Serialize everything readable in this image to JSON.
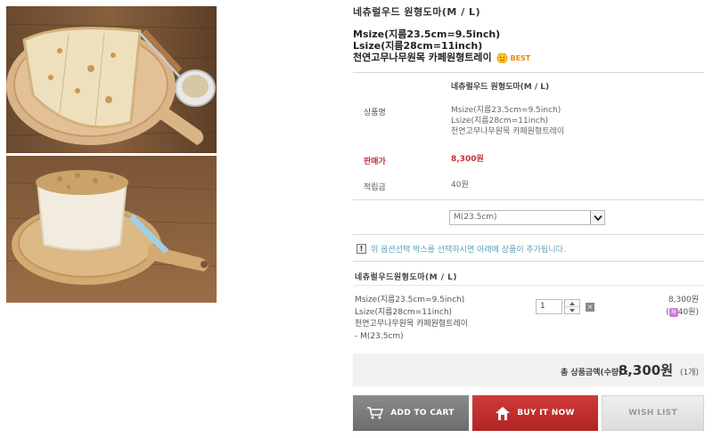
{
  "product": {
    "title": "네츄럴우드 원형도마(M / L)",
    "desc_lines": [
      "Msize(지름23.5cm=9.5inch)",
      "Lsize(지름28cm=11inch)",
      "천연고무나무원목 카페원형트레이"
    ],
    "best_badge": "BEST"
  },
  "details": {
    "name_title": "네츄럴우드 원형도마(M / L)",
    "name_label": "상품명",
    "name_lines": [
      "Msize(지름23.5cm=9.5inch)",
      "Lsize(지름28cm=11inch)",
      "천연고무나무원목 카페원형트레이"
    ],
    "price_label": "판매가",
    "price_value": "8,300원",
    "points_label": "적립금",
    "points_value": "40원"
  },
  "option": {
    "selected": "M(23.5cm)"
  },
  "notice": {
    "icon": "!",
    "text": "위 옵션선택 박스를 선택하시면 아래에 상품이 추가됩니다."
  },
  "selected_item": {
    "title": "네츄럴우드원형도마(M / L)",
    "desc_lines": [
      "Msize(지름23.5cm=9.5inch)",
      "Lsize(지름28cm=11inch)",
      "천연고무나무원목 카페원형트레이",
      "- M(23.5cm)"
    ],
    "quantity": "1",
    "delete_symbol": "×",
    "price": "8,300원",
    "points_badge": "적",
    "points": "40원)",
    "points_open": "("
  },
  "total": {
    "label": "총 상품금액(수량) :",
    "value": "8,300원",
    "count": "(1개)"
  },
  "buttons": {
    "cart": "ADD TO CART",
    "buy": "BUY IT NOW",
    "wish": "WISH LIST"
  },
  "colors": {
    "price_red": "#c7303b",
    "notice_blue": "#5aa0b5",
    "buy_red": "#b32323",
    "cart_gray": "#6c6c6c"
  },
  "icons": {
    "best": "smiley-badge-icon",
    "cart": "cart-icon",
    "buy": "house-icon",
    "notice": "exclamation-icon",
    "select": "chevron-down-icon"
  }
}
